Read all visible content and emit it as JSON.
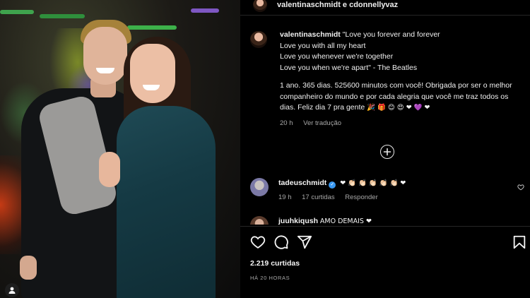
{
  "post": {
    "header_title": "valentinaschmidt e cdonnellyvaz",
    "caption_user": "valentinaschmidt",
    "caption_lines": [
      "\"Love you forever and forever",
      "Love you with all my heart",
      "Love you whenever we're together",
      "Love you when we're apart\" - The Beatles"
    ],
    "caption_paragraph": "1 ano. 365 dias. 525600 minutos com você! Obrigada por ser o melhor companheiro do mundo e por cada alegria que você me traz todos os dias. Feliz dia 7 pra gente",
    "caption_emojis": "🎉 🎁 😊 😍 ❤ 💜 ❤",
    "caption_time": "20 h",
    "see_translation": "Ver tradução"
  },
  "comments": [
    {
      "user": "tadeuschmidt",
      "verified": true,
      "text": "❤ 👏🏻 👏🏻 👏🏻 👏🏻 👏🏻 ❤",
      "time": "19 h",
      "likes": "17 curtidas",
      "reply": "Responder"
    },
    {
      "user": "juuhkiqush",
      "text": "AMO DEMAIS ❤"
    }
  ],
  "footer": {
    "likes_count": "2.219 curtidas",
    "time_ago": "HÁ 20 HORAS"
  },
  "icons": {
    "like": "heart-icon",
    "comment": "comment-icon",
    "share": "share-icon",
    "save": "bookmark-icon",
    "load_more": "plus-circle-icon",
    "photo_tags": "user-tag-icon"
  },
  "colors": {
    "background": "#000000",
    "text": "#f5f5f5",
    "muted": "#a8a8a8",
    "divider": "#262626",
    "verified": "#3897f0"
  }
}
